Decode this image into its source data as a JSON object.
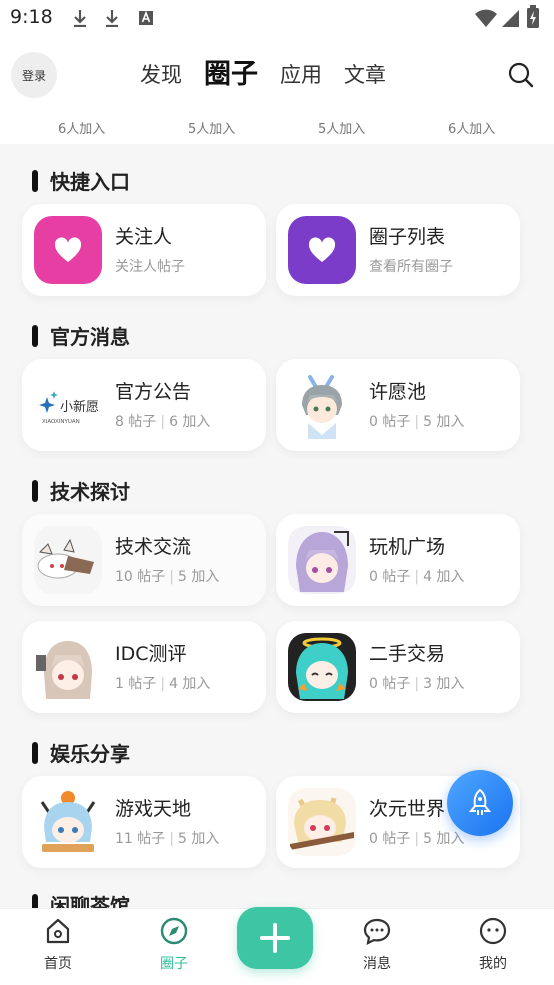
{
  "status_bar": {
    "time": "9:18"
  },
  "header": {
    "login_label": "登录",
    "tabs": [
      {
        "label": "发现"
      },
      {
        "label": "圈子"
      },
      {
        "label": "应用"
      },
      {
        "label": "文章"
      }
    ],
    "active_tab": "圈子"
  },
  "joined_counts": [
    "6人加入",
    "5人加入",
    "5人加入",
    "6人加入"
  ],
  "sections": [
    {
      "title": "快捷入口",
      "cards": [
        {
          "name": "关注人",
          "sub": "关注人帖子",
          "icon": "heart-icon",
          "color": "#e63ea3"
        },
        {
          "name": "圈子列表",
          "sub": "查看所有圈子",
          "icon": "heart-icon",
          "color": "#7a3cc9"
        }
      ]
    },
    {
      "title": "官方消息",
      "cards": [
        {
          "name": "官方公告",
          "posts": "8 帖子",
          "joined": "6 加入",
          "logo_text": "小新愿",
          "logo_sub": "XIAOXINYUAN"
        },
        {
          "name": "许愿池",
          "posts": "0 帖子",
          "joined": "5 加入"
        }
      ]
    },
    {
      "title": "技术探讨",
      "cards": [
        {
          "name": "技术交流",
          "posts": "10 帖子",
          "joined": "5 加入"
        },
        {
          "name": "玩机广场",
          "posts": "0 帖子",
          "joined": "4 加入"
        },
        {
          "name": "IDC测评",
          "posts": "1 帖子",
          "joined": "4 加入"
        },
        {
          "name": "二手交易",
          "posts": "0 帖子",
          "joined": "3 加入"
        }
      ]
    },
    {
      "title": "娱乐分享",
      "cards": [
        {
          "name": "游戏天地",
          "posts": "11 帖子",
          "joined": "5 加入"
        },
        {
          "name": "次元世界",
          "posts": "0 帖子",
          "joined": "5 加入"
        }
      ]
    },
    {
      "title": "闲聊茶馆",
      "cards": []
    }
  ],
  "bottom_nav": [
    {
      "label": "首页",
      "icon": "home-icon"
    },
    {
      "label": "圈子",
      "icon": "compass-icon"
    },
    {
      "label": "",
      "icon": "plus-icon"
    },
    {
      "label": "消息",
      "icon": "chat-icon"
    },
    {
      "label": "我的",
      "icon": "profile-icon"
    }
  ],
  "colors": {
    "accent": "#3ec6a4",
    "fab": "#1a73f0"
  }
}
